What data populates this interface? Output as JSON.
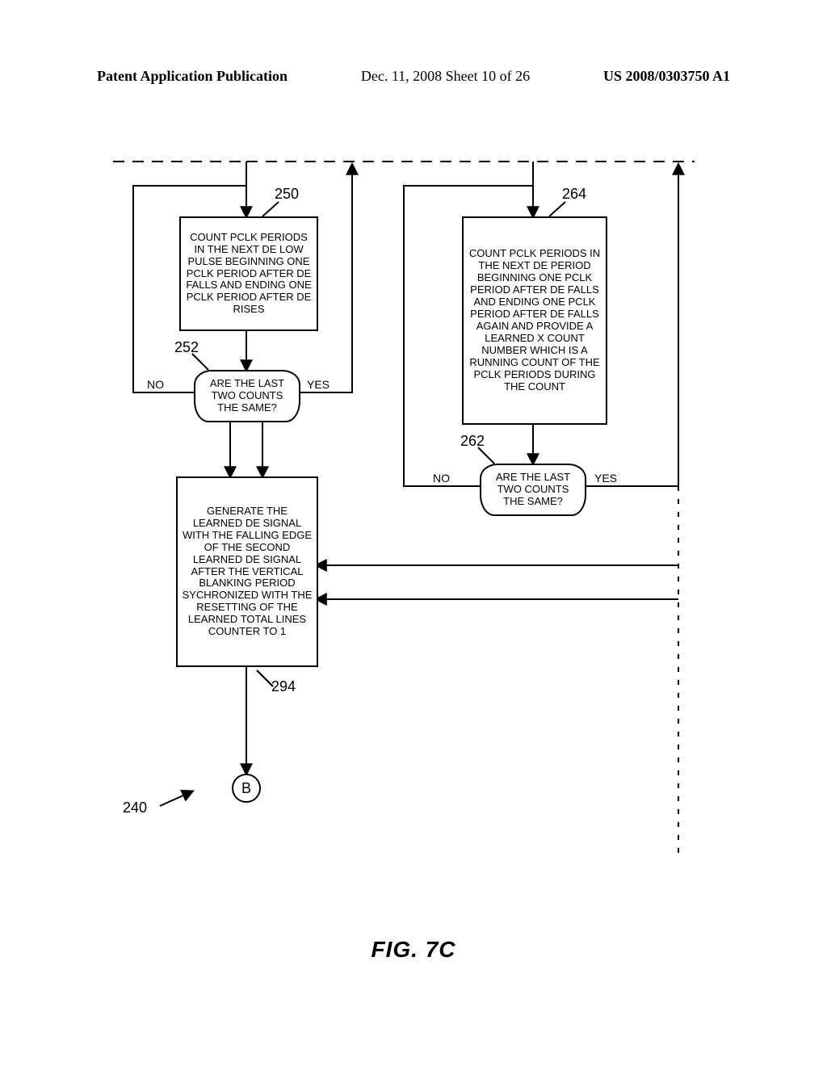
{
  "header": {
    "left": "Patent Application Publication",
    "center": "Dec. 11, 2008  Sheet 10 of 26",
    "right": "US 2008/0303750 A1"
  },
  "refs": {
    "r250": "250",
    "r252": "252",
    "r264": "264",
    "r262": "262",
    "r294": "294",
    "r240": "240"
  },
  "labels": {
    "no_left": "NO",
    "yes_left": "YES",
    "no_right": "NO",
    "yes_right": "YES"
  },
  "boxes": {
    "b250": "COUNT PCLK PERIODS IN THE NEXT DE LOW PULSE BEGINNING ONE PCLK PERIOD AFTER DE FALLS AND ENDING ONE PCLK PERIOD AFTER DE RISES",
    "d252": "ARE THE LAST TWO COUNTS THE SAME?",
    "b264": "COUNT PCLK PERIODS IN THE NEXT DE PERIOD BEGINNING ONE PCLK PERIOD AFTER DE FALLS AND ENDING ONE PCLK PERIOD AFTER DE FALLS AGAIN AND PROVIDE A LEARNED X COUNT NUMBER WHICH IS A RUNNING COUNT OF THE PCLK PERIODS DURING THE COUNT",
    "d262": "ARE THE LAST TWO COUNTS THE SAME?",
    "b294": "GENERATE THE LEARNED DE SIGNAL WITH THE FALLING EDGE OF THE SECOND LEARNED DE SIGNAL AFTER THE VERTICAL BLANKING PERIOD SYCHRONIZED WITH THE RESETTING OF THE LEARNED TOTAL LINES COUNTER TO 1"
  },
  "connector": {
    "B": "B"
  },
  "figure_caption": "FIG. 7C"
}
